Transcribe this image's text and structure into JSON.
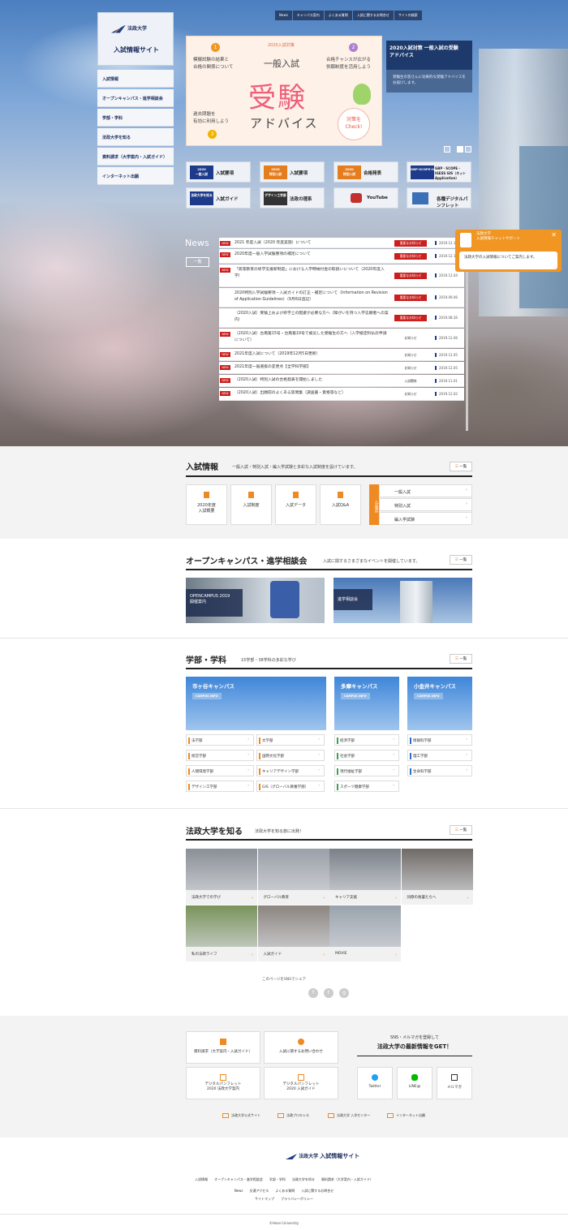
{
  "site": {
    "brand": "法政大学",
    "title": "入試情報サイト"
  },
  "sidenav": [
    "入試情報",
    "オープンキャンパス・進学相談会",
    "学部・学科",
    "法政大学を知る",
    "資料請求（大学案内・入試ガイド）",
    "インターネット出願"
  ],
  "topnav": [
    "News",
    "キャンパス案内",
    "よくある質問",
    "入試に関するお問合せ",
    "サイト内検索"
  ],
  "banner": {
    "sub": "2020入試対策",
    "line1": "一般入試",
    "big": "受験",
    "line2": "アドバイス",
    "note1": "模擬試験の結果と\n合格の関係について",
    "note2": "合格チャンスが広がる\n併願制度を活用しよう",
    "note3": "過去問題を\n有効に利用しよう",
    "check": "対策を\nCheck!",
    "n1": "1",
    "n2": "2",
    "n3": "3"
  },
  "side_card": {
    "title": "2020入試対策 一般入試の受験アドバイス",
    "body": "受験生の皆さんに効果的な受験アドバイスをお届けします。"
  },
  "quick": [
    {
      "tag": "2020\n一般入試",
      "label": "入試要項",
      "color": "#1d3b8a"
    },
    {
      "tag": "2020\n特別入試",
      "label": "入試要項",
      "color": "#e57c1d"
    },
    {
      "tag": "2020\n特別入試",
      "label": "合格発表",
      "color": "#e57c1d"
    },
    {
      "tag": "GBP-SCOPE-IGESS GIS",
      "label": "GBP・SCOPE・IGESS GIS（ネット Application）",
      "color": "#1d3b8a"
    },
    {
      "tag": "法政大学を知る",
      "label": "入試ガイド",
      "color": "#1d3b8a"
    },
    {
      "tag": "デザイン工学部",
      "label": "法政の理系",
      "color": "#333"
    },
    {
      "tag": "",
      "label": "YouTube",
      "color": "#c4302b"
    },
    {
      "tag": "",
      "label": "各種デジタルパンフレット",
      "color": "#1d3b8a"
    }
  ],
  "news": {
    "heading": "News",
    "all": "一覧",
    "items": [
      {
        "new": "NEW",
        "text": "2021 年度入試（2020 年度実施）について",
        "tag": "重要なお知らせ",
        "date": "2019.12.1"
      },
      {
        "new": "NEW",
        "text": "2020年度一般入学試験要項の補足について",
        "tag": "重要なお知らせ",
        "date": "2019.12.1"
      },
      {
        "new": "NEW",
        "text": "「高等教育の修学支援新制度」における入学時納付金の取扱いについて（2020年度入学）",
        "tag": "重要なお知らせ",
        "date": "2019.12.04"
      },
      {
        "new": "",
        "text": "2020特別入学試験要項・入試ガイドの訂正・補足について（Information on Revision of Application Guidelines）（9月6日追記）",
        "tag": "重要なお知らせ",
        "date": "2019.09.06"
      },
      {
        "new": "",
        "text": "（2020入試）受験上および修学上の配慮が必要な方へ（障がいを持つ入学志願者への案内）",
        "tag": "重要なお知らせ",
        "date": "2019.08.26"
      },
      {
        "new": "NEW",
        "text": "（2020入試）台風第15号・台風第19号で被災した受験生の方へ（入学検定料払戻申請について）",
        "tag": "お知らせ",
        "date": "2019.12.06"
      },
      {
        "new": "NEW",
        "text": "2021年度入試について（2019年12月5日更新）",
        "tag": "お知らせ",
        "date": "2019.12.05"
      },
      {
        "new": "NEW",
        "text": "2021年度一般選抜の変更点【全学科学部】",
        "tag": "お知らせ",
        "date": "2019.12.05"
      },
      {
        "new": "NEW",
        "text": "（2020入試）特別入試の合格発表を開始しました",
        "tag": "入試関係",
        "date": "2019.11.01"
      },
      {
        "new": "NEW",
        "text": "（2020入試）出願前のよくある質問集（調査書・資格等など）",
        "tag": "お知らせ",
        "date": "2019.12.02"
      }
    ]
  },
  "chat": {
    "label": "法政大学",
    "title": "入試情報チャットサポート",
    "msg": "法政大学の入試情報についてご案内します。",
    "close": "✕"
  },
  "s1": {
    "title": "入試情報",
    "sub": "一般入試・特別入試・編入学試験と多彩な入試制度を設けています。",
    "all": "一覧",
    "cards": [
      "2020年度\n入試概要",
      "入試制度",
      "入試データ",
      "入試Q&A"
    ],
    "tab": "入試種別",
    "links": [
      "一般入試",
      "特別入試",
      "編入学試験"
    ]
  },
  "s2": {
    "title": "オープンキャンパス・進学相談会",
    "sub": "入試に関するさまざまなイベントを開催しています。",
    "all": "一覧",
    "b1": "OPENCAMPUS 2019\n開催案内",
    "b2": "進学相談会"
  },
  "s3": {
    "title": "学部・学科",
    "sub": "15学部・38学科の多彩な学び",
    "all": "一覧",
    "camp": [
      {
        "name": "市ヶ谷キャンパス",
        "info": "CAMPUS INFO"
      },
      {
        "name": "多摩キャンパス",
        "info": "CAMPUS INFO"
      },
      {
        "name": "小金井キャンパス",
        "info": "CAMPUS INFO"
      }
    ],
    "ichigaya": [
      "法学部",
      "文学部",
      "経営学部",
      "国際文化学部",
      "人間環境学部",
      "キャリアデザイン学部",
      "デザイン工学部",
      "GIS（グローバル教養学部）"
    ],
    "tama": [
      "経済学部",
      "社会学部",
      "現代福祉学部",
      "スポーツ健康学部"
    ],
    "koganei": [
      "情報科学部",
      "理工学部",
      "生命科学部"
    ]
  },
  "s4": {
    "title": "法政大学を知る",
    "sub": "法政大学を知る旅に出発！",
    "all": "一覧",
    "photos": [
      "法政大学での学び",
      "グローバル教育",
      "キャリア支援",
      "同僚の後輩たちへ",
      "私の法政ライフ",
      "入試ガイド",
      "MOVIE"
    ],
    "share": "このページをSNSでシェア",
    "sns": [
      "f",
      "t",
      "g"
    ]
  },
  "footer": {
    "btns": [
      "資料請求（大学案内・入試ガイド）",
      "入試に関するお問い合わせ",
      "デジタルパンフレット\n2020 法政大学案内",
      "デジタルパンフレット\n2020 入試ガイド"
    ],
    "sns_head": "SNS・メルマガを登録して",
    "sns_title": "法政大学の最新情報をGET！",
    "sns": [
      "Twitter",
      "LINE@",
      "メルマガ"
    ],
    "links": [
      "法政大学公式サイト",
      "法政プロキシス",
      "法政大学 入学センター",
      "インターネット出願"
    ],
    "nav1": [
      "入試情報",
      "オープンキャンパス・進学相談会",
      "学部・学科",
      "法政大学を知る",
      "資料請求（大学案内・入試ガイド）"
    ],
    "nav2": [
      "News",
      "交通アクセス",
      "よくある質問",
      "入試に関するお問合せ"
    ],
    "nav3": [
      "サイトマップ",
      "プライバシーポリシー"
    ],
    "copy": "©Hosei University"
  }
}
